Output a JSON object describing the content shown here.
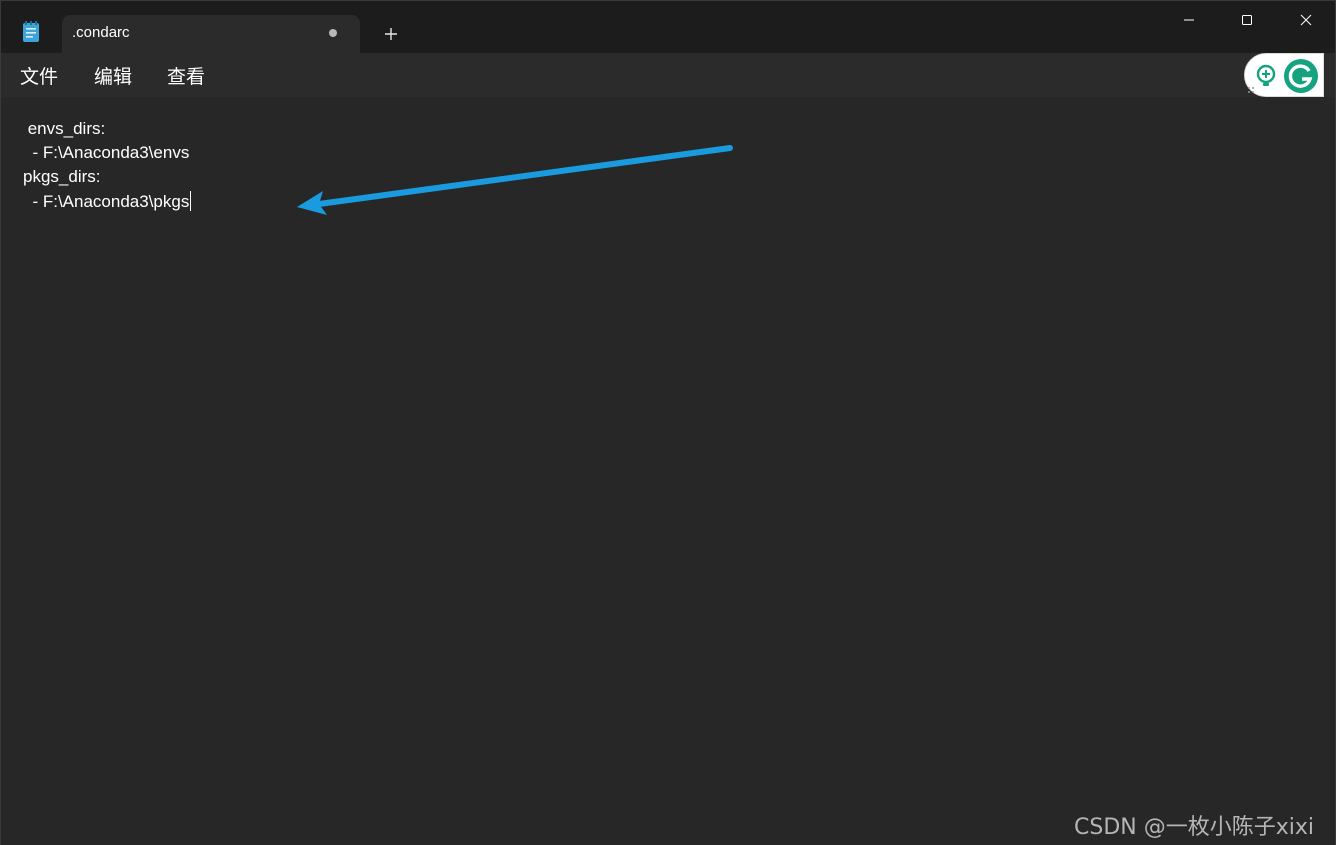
{
  "tab": {
    "title": ".condarc"
  },
  "menu": {
    "file": "文件",
    "edit": "编辑",
    "view": "查看"
  },
  "editor": {
    "lines": [
      " envs_dirs:",
      "  - F:\\Anaconda3\\envs",
      "pkgs_dirs:",
      "  - F:\\Anaconda3\\pkgs"
    ]
  },
  "watermark": "CSDN @一枚小陈子xixi",
  "colors": {
    "arrow": "#1a9be0",
    "grammarly": "#15a37f"
  },
  "icons": {
    "app": "notepad-icon",
    "unsaved": "unsaved-dot-icon",
    "new_tab": "plus-icon",
    "minimize": "minimize-icon",
    "maximize": "maximize-icon",
    "close": "close-icon",
    "grammarly": "grammarly-icon"
  }
}
